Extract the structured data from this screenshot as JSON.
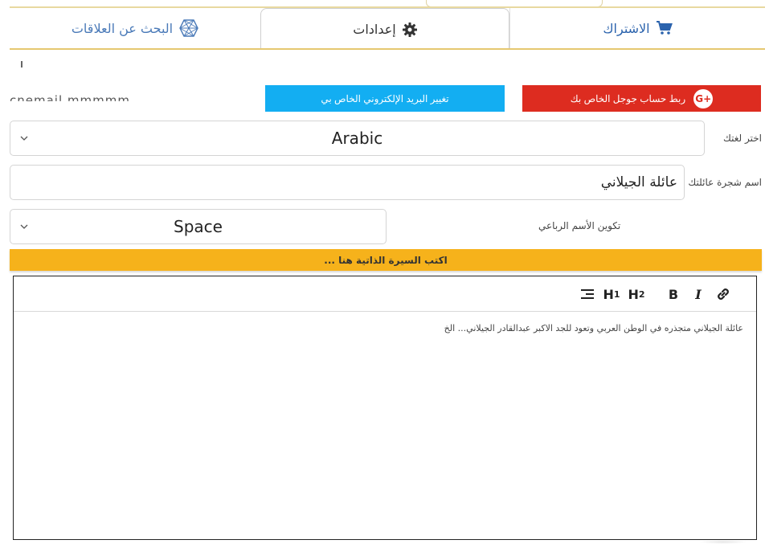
{
  "tabs": {
    "family_search": "البحث عن العلاقات",
    "settings": "إعدادات",
    "subscribe": "الاشتراك"
  },
  "buttons": {
    "google_link": "ربط حساب جوجل الخاص بك",
    "google_logo": "G+",
    "change_email": "تغيير البريد الإلكتروني الخاص بي"
  },
  "partial_text": "cnemail mmmmm",
  "form": {
    "language_label": "اختر لغتك",
    "language_value": "Arabic",
    "tree_label": "اسم شجرة عائلتك",
    "tree_value": "عائلة الجيلاني",
    "quad_label": "تكوين الأسم الرباعي",
    "quad_value": "Space"
  },
  "bio": {
    "banner": "اكتب السيرة الذاتية هنا ...",
    "content": "عائلة الجيلاني متجذره في الوطن العربي وتعود للجد الاكبر عبدالقادر الجيلاني... الخ"
  },
  "toolbar": {
    "h1": "H",
    "h2": "H",
    "h1_sub": "1",
    "h2_sub": "2",
    "bold": "B",
    "italic": "I"
  },
  "colors": {
    "google_red": "#dd2c20",
    "email_blue": "#13aef2",
    "banner_yellow": "#f6b21b",
    "tab_blue": "#2b63ad"
  },
  "icons": {
    "family_search": "network-icon",
    "settings": "gear-icon",
    "subscribe": "cart-icon",
    "align": "align-right-icon",
    "link": "link-icon"
  }
}
